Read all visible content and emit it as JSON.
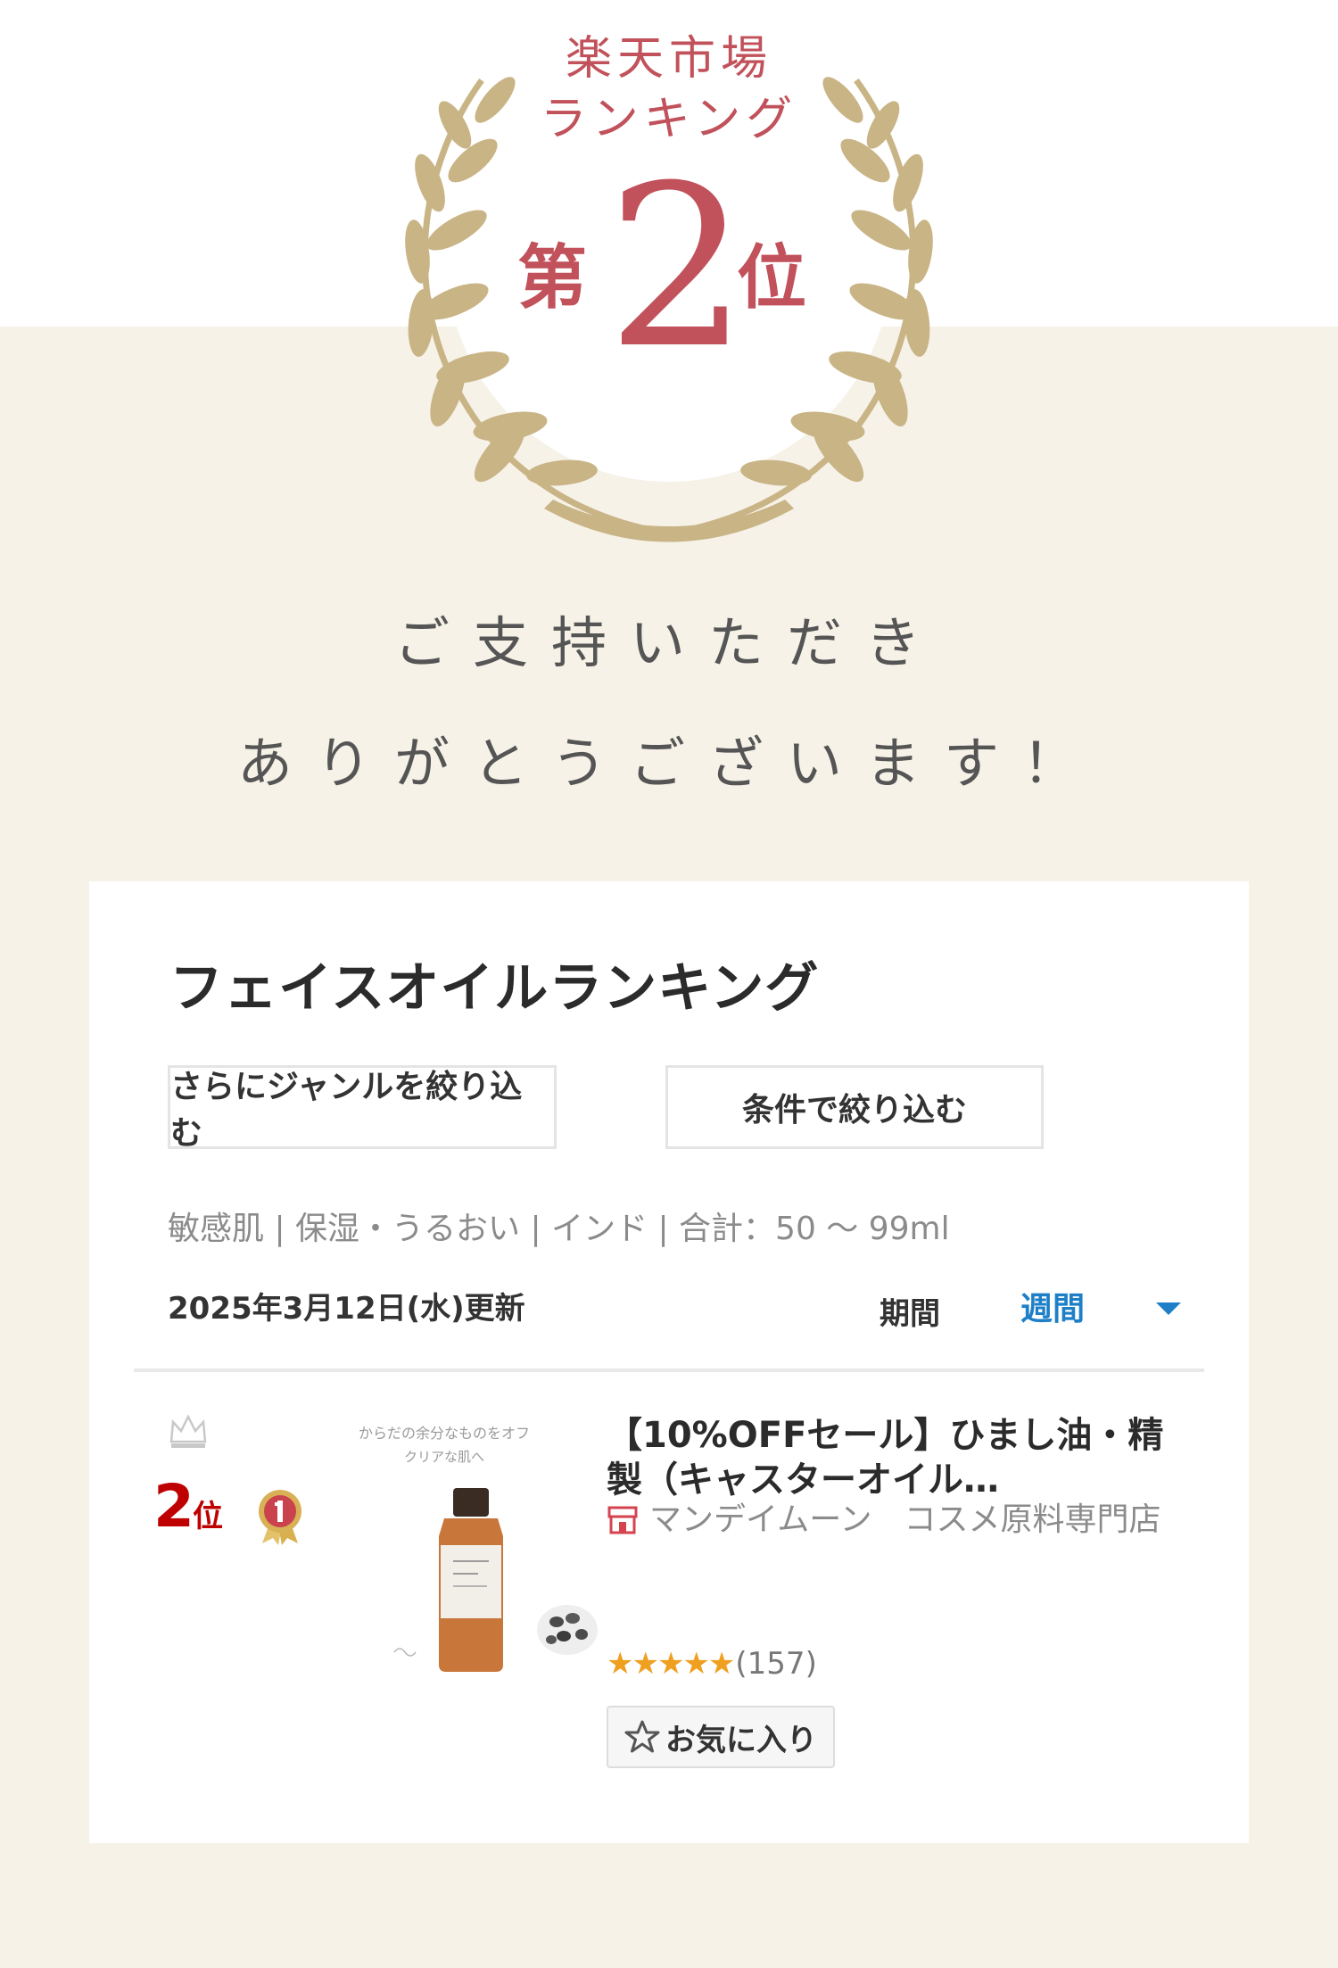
{
  "award": {
    "market_line1": "楽天市場",
    "market_line2": "ランキング",
    "rank_prefix": "第",
    "rank_number": "2",
    "rank_suffix": "位",
    "laurel_color": "#c9b486",
    "accent_color": "#c1515a"
  },
  "thanks": {
    "line1": "ご支持いただき",
    "line2": "ありがとうございます！"
  },
  "ranking_card": {
    "title": "フェイスオイルランキング",
    "genre_button": "さらにジャンルを絞り込む",
    "condition_button": "条件で絞り込む",
    "filters": "敏感肌 | 保湿・うるおい | インド | 合計：50 ～ 99ml",
    "updated": "2025年3月12日(水)更新",
    "period_label": "期間",
    "period_value": "週間",
    "item": {
      "rank_number": "2",
      "rank_unit": "位",
      "image_caption_1": "からだの余分なものをオフ",
      "image_caption_2": "クリアな肌へ",
      "title": "【10%OFFセール】ひまし油・精製（キャスターオイル…",
      "shop": "マンデイムーン　コスメ原料専門店",
      "stars": "★★★★★",
      "review_count": "(157)",
      "rating": 4.5,
      "favorite_label": "お気に入り"
    }
  }
}
